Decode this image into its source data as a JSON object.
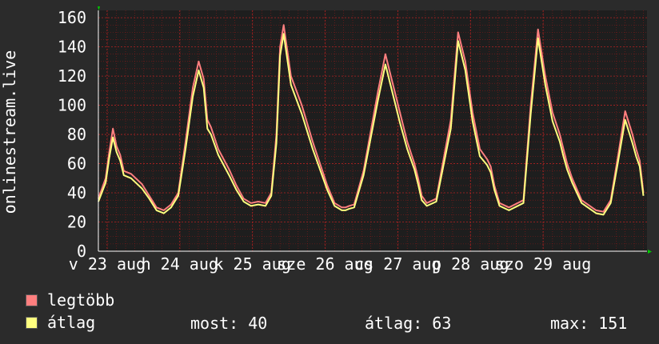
{
  "chart_data": {
    "type": "line",
    "ylabel": "onlinestream.live",
    "ylim": [
      0,
      165
    ],
    "yticks": [
      0,
      20,
      40,
      60,
      80,
      100,
      120,
      140,
      160
    ],
    "xlim": [
      0,
      7.55
    ],
    "xtick_labels": [
      "v 23 aug",
      "h 24 aug",
      "k 25 aug",
      "sze 26 aug",
      "cs 27 aug",
      "p 28 aug",
      "szo 29 aug"
    ],
    "grid": true,
    "colors": {
      "background": "#2b2b2b",
      "plot_bg": "#1e1e1e",
      "grid": "#8b1a1a",
      "legtobb": "#ff7f7f",
      "atlag": "#ffff7f"
    },
    "series": [
      {
        "name": "legtöbb",
        "color": "#ff7f7f",
        "x": [
          0.0,
          0.1,
          0.15,
          0.2,
          0.25,
          0.3,
          0.35,
          0.45,
          0.6,
          0.7,
          0.8,
          0.9,
          1.0,
          1.1,
          1.2,
          1.3,
          1.38,
          1.45,
          1.5,
          1.55,
          1.65,
          1.8,
          1.9,
          2.0,
          2.1,
          2.2,
          2.3,
          2.38,
          2.45,
          2.5,
          2.55,
          2.65,
          2.8,
          2.95,
          3.05,
          3.15,
          3.25,
          3.35,
          3.4,
          3.45,
          3.52,
          3.65,
          3.85,
          3.95,
          4.05,
          4.15,
          4.25,
          4.35,
          4.4,
          4.45,
          4.52,
          4.65,
          4.85,
          4.95,
          5.05,
          5.15,
          5.25,
          5.35,
          5.4,
          5.45,
          5.52,
          5.65,
          5.85,
          5.95,
          6.05,
          6.15,
          6.25,
          6.35,
          6.4,
          6.45,
          6.52,
          6.65,
          6.85,
          6.95,
          7.05,
          7.15,
          7.25,
          7.35,
          7.4,
          7.45,
          7.5
        ],
        "y": [
          36,
          50,
          68,
          84,
          72,
          66,
          55,
          53,
          46,
          38,
          30,
          28,
          32,
          40,
          75,
          112,
          130,
          118,
          90,
          85,
          70,
          56,
          45,
          36,
          33,
          34,
          33,
          40,
          80,
          140,
          155,
          120,
          100,
          75,
          60,
          45,
          33,
          30,
          30,
          31,
          32,
          55,
          110,
          135,
          115,
          95,
          75,
          60,
          50,
          38,
          33,
          36,
          90,
          150,
          130,
          95,
          70,
          63,
          58,
          45,
          33,
          30,
          35,
          100,
          152,
          120,
          95,
          80,
          70,
          60,
          50,
          35,
          28,
          27,
          35,
          65,
          96,
          80,
          70,
          62,
          40
        ]
      },
      {
        "name": "átlag",
        "color": "#ffff7f",
        "x": [
          0.0,
          0.1,
          0.15,
          0.2,
          0.25,
          0.3,
          0.35,
          0.45,
          0.6,
          0.7,
          0.8,
          0.9,
          1.0,
          1.1,
          1.2,
          1.3,
          1.38,
          1.45,
          1.5,
          1.55,
          1.65,
          1.8,
          1.9,
          2.0,
          2.1,
          2.2,
          2.3,
          2.38,
          2.45,
          2.5,
          2.55,
          2.65,
          2.8,
          2.95,
          3.05,
          3.15,
          3.25,
          3.35,
          3.4,
          3.45,
          3.52,
          3.65,
          3.85,
          3.95,
          4.05,
          4.15,
          4.25,
          4.35,
          4.4,
          4.45,
          4.52,
          4.65,
          4.85,
          4.95,
          5.05,
          5.15,
          5.25,
          5.35,
          5.4,
          5.45,
          5.52,
          5.65,
          5.85,
          5.95,
          6.05,
          6.15,
          6.25,
          6.35,
          6.4,
          6.45,
          6.52,
          6.65,
          6.85,
          6.95,
          7.05,
          7.15,
          7.25,
          7.35,
          7.4,
          7.45,
          7.5
        ],
        "y": [
          34,
          47,
          64,
          78,
          68,
          62,
          52,
          50,
          43,
          36,
          28,
          26,
          30,
          38,
          70,
          106,
          124,
          112,
          84,
          80,
          66,
          52,
          42,
          34,
          31,
          32,
          31,
          38,
          74,
          134,
          149,
          114,
          94,
          70,
          56,
          42,
          31,
          28,
          28,
          29,
          30,
          52,
          104,
          128,
          108,
          88,
          70,
          56,
          46,
          35,
          31,
          34,
          84,
          144,
          124,
          89,
          65,
          59,
          54,
          42,
          31,
          28,
          33,
          94,
          146,
          114,
          89,
          75,
          65,
          56,
          47,
          33,
          26,
          25,
          33,
          61,
          90,
          74,
          65,
          58,
          38
        ]
      }
    ]
  },
  "legend": {
    "legtobb_label": "legtöbb",
    "atlag_label": "átlag"
  },
  "stats": {
    "most_label": "most:",
    "most_value": "40",
    "atlag_label": "átlag:",
    "atlag_value": "63",
    "max_label": "max:",
    "max_value": "151"
  }
}
